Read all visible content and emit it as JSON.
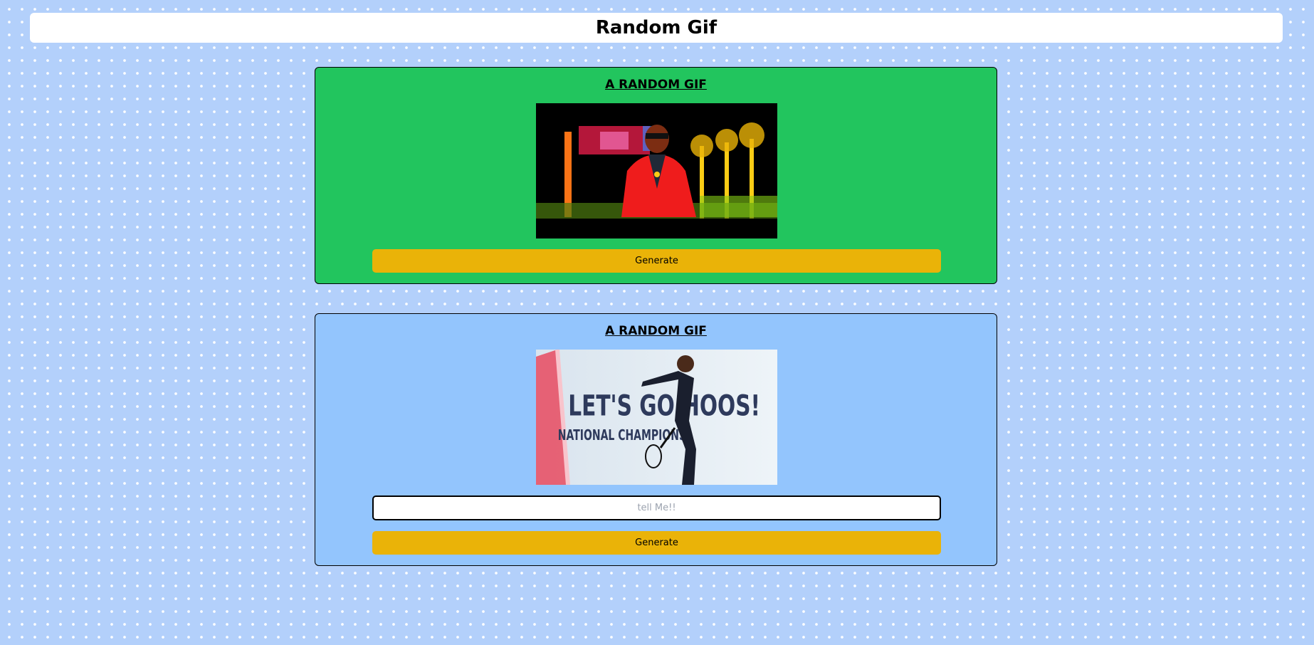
{
  "page": {
    "title": "Random Gif"
  },
  "random_card": {
    "title": "A RANDOM GIF",
    "generate_label": "Generate"
  },
  "tag_card": {
    "title": "A RANDOM GIF",
    "input_placeholder": "tell Me!!",
    "input_value": "",
    "generate_label": "Generate",
    "gif_text_line1": "LET'S GO HOOS!",
    "gif_text_line2": "NATIONAL CHAMPIONS"
  },
  "colors": {
    "background": "#b3d0fb",
    "random_card_bg": "#22c55e",
    "tag_card_bg": "#93c5fd",
    "button_bg": "#eab308"
  }
}
